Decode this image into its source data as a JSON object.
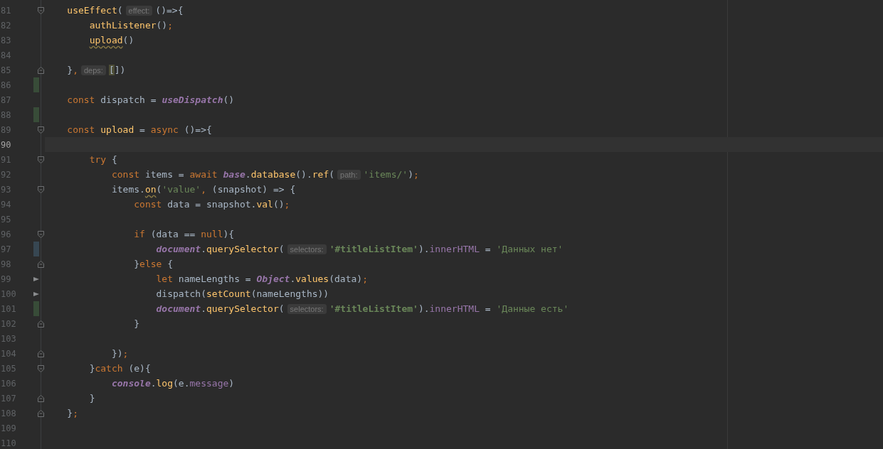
{
  "lines": [
    {
      "number": "81",
      "current": false,
      "added": false,
      "modified": false,
      "fold_start": true,
      "fold_end": false,
      "run_marker": false,
      "tokens": [
        {
          "text": "    useEffect",
          "kind": "function"
        },
        {
          "text": "(",
          "kind": "plain"
        },
        {
          "text": "effect:",
          "kind": "hint"
        },
        {
          "text": "()=>{",
          "kind": "plain"
        }
      ]
    },
    {
      "number": "82",
      "current": false,
      "added": false,
      "modified": false,
      "fold_start": false,
      "fold_end": false,
      "run_marker": false,
      "tokens": [
        {
          "text": "        authListener",
          "kind": "function"
        },
        {
          "text": "()",
          "kind": "plain"
        },
        {
          "text": ";",
          "kind": "punct"
        }
      ]
    },
    {
      "number": "83",
      "current": false,
      "added": false,
      "modified": false,
      "fold_start": false,
      "fold_end": false,
      "run_marker": false,
      "tokens": [
        {
          "text": "        upload",
          "kind": "function-warning"
        },
        {
          "text": "()",
          "kind": "plain"
        }
      ]
    },
    {
      "number": "84",
      "current": false,
      "added": false,
      "modified": false,
      "fold_start": false,
      "fold_end": false,
      "run_marker": false
    },
    {
      "number": "85",
      "current": false,
      "added": false,
      "modified": false,
      "fold_start": false,
      "fold_end": true,
      "run_marker": false,
      "tokens": [
        {
          "text": "    }",
          "kind": "plain"
        },
        {
          "text": ",",
          "kind": "punct"
        },
        {
          "text": "deps:",
          "kind": "hint"
        },
        {
          "text": "[",
          "kind": "bracket-match"
        },
        {
          "text": "])",
          "kind": "plain"
        }
      ]
    },
    {
      "number": "86",
      "current": false,
      "added": true,
      "modified": false,
      "fold_start": false,
      "fold_end": false,
      "run_marker": false
    },
    {
      "number": "87",
      "current": false,
      "added": false,
      "modified": false,
      "fold_start": false,
      "fold_end": false,
      "run_marker": false,
      "tokens": [
        {
          "text": "    const",
          "kind": "keyword"
        },
        {
          "text": " dispatch = ",
          "kind": "plain"
        },
        {
          "text": "useDispatch",
          "kind": "global"
        },
        {
          "text": "()",
          "kind": "plain"
        }
      ]
    },
    {
      "number": "88",
      "current": false,
      "added": true,
      "modified": false,
      "fold_start": false,
      "fold_end": false,
      "run_marker": false
    },
    {
      "number": "89",
      "current": false,
      "added": false,
      "modified": false,
      "fold_start": true,
      "fold_end": false,
      "run_marker": false,
      "tokens": [
        {
          "text": "    const",
          "kind": "keyword"
        },
        {
          "text": " upload",
          "kind": "function"
        },
        {
          "text": " = ",
          "kind": "plain"
        },
        {
          "text": "async",
          "kind": "keyword"
        },
        {
          "text": " ()=>{",
          "kind": "plain"
        }
      ]
    },
    {
      "number": "90",
      "current": true,
      "added": false,
      "modified": false,
      "fold_start": false,
      "fold_end": false,
      "run_marker": false
    },
    {
      "number": "91",
      "current": false,
      "added": false,
      "modified": false,
      "fold_start": true,
      "fold_end": false,
      "run_marker": false,
      "tokens": [
        {
          "text": "        try",
          "kind": "keyword"
        },
        {
          "text": " {",
          "kind": "plain"
        }
      ]
    },
    {
      "number": "92",
      "current": false,
      "added": false,
      "modified": false,
      "fold_start": false,
      "fold_end": false,
      "run_marker": false,
      "tokens": [
        {
          "text": "            const",
          "kind": "keyword"
        },
        {
          "text": " items = ",
          "kind": "plain"
        },
        {
          "text": "await ",
          "kind": "keyword"
        },
        {
          "text": "base",
          "kind": "global"
        },
        {
          "text": ".",
          "kind": "plain"
        },
        {
          "text": "database",
          "kind": "function"
        },
        {
          "text": "().",
          "kind": "plain"
        },
        {
          "text": "ref",
          "kind": "function"
        },
        {
          "text": "(",
          "kind": "plain"
        },
        {
          "text": "path:",
          "kind": "hint"
        },
        {
          "text": "'items/'",
          "kind": "string"
        },
        {
          "text": ")",
          "kind": "plain"
        },
        {
          "text": ";",
          "kind": "punct"
        }
      ]
    },
    {
      "number": "93",
      "current": false,
      "added": false,
      "modified": false,
      "fold_start": true,
      "fold_end": false,
      "run_marker": false,
      "tokens": [
        {
          "text": "            items.",
          "kind": "plain"
        },
        {
          "text": "on",
          "kind": "function-warning"
        },
        {
          "text": "(",
          "kind": "plain"
        },
        {
          "text": "'value'",
          "kind": "string"
        },
        {
          "text": ",",
          "kind": "punct"
        },
        {
          "text": " (snapshot) => {",
          "kind": "plain"
        }
      ]
    },
    {
      "number": "94",
      "current": false,
      "added": false,
      "modified": false,
      "fold_start": false,
      "fold_end": false,
      "run_marker": false,
      "tokens": [
        {
          "text": "                const",
          "kind": "keyword"
        },
        {
          "text": " data = snapshot.",
          "kind": "plain"
        },
        {
          "text": "val",
          "kind": "function"
        },
        {
          "text": "()",
          "kind": "plain"
        },
        {
          "text": ";",
          "kind": "punct"
        }
      ]
    },
    {
      "number": "95",
      "current": false,
      "added": false,
      "modified": false,
      "fold_start": false,
      "fold_end": false,
      "run_marker": false
    },
    {
      "number": "96",
      "current": false,
      "added": false,
      "modified": false,
      "fold_start": true,
      "fold_end": false,
      "run_marker": false,
      "tokens": [
        {
          "text": "                if",
          "kind": "keyword"
        },
        {
          "text": " (data == ",
          "kind": "plain"
        },
        {
          "text": "null",
          "kind": "keyword"
        },
        {
          "text": "){",
          "kind": "plain"
        }
      ]
    },
    {
      "number": "97",
      "current": false,
      "added": false,
      "modified": true,
      "fold_start": false,
      "fold_end": false,
      "run_marker": false,
      "tokens": [
        {
          "text": "                    document",
          "kind": "global"
        },
        {
          "text": ".",
          "kind": "plain"
        },
        {
          "text": "querySelector",
          "kind": "function"
        },
        {
          "text": "(",
          "kind": "plain"
        },
        {
          "text": "selectors:",
          "kind": "hint"
        },
        {
          "text": "'#titleListItem'",
          "kind": "string-bold"
        },
        {
          "text": ").",
          "kind": "plain"
        },
        {
          "text": "innerHTML",
          "kind": "property"
        },
        {
          "text": " = ",
          "kind": "plain"
        },
        {
          "text": "'Данных нет'",
          "kind": "string"
        }
      ]
    },
    {
      "number": "98",
      "current": false,
      "added": false,
      "modified": false,
      "fold_start": false,
      "fold_end": true,
      "run_marker": false,
      "tokens": [
        {
          "text": "                }",
          "kind": "plain"
        },
        {
          "text": "else",
          "kind": "keyword"
        },
        {
          "text": " {",
          "kind": "plain"
        }
      ]
    },
    {
      "number": "99",
      "current": false,
      "added": false,
      "modified": false,
      "fold_start": false,
      "fold_end": false,
      "run_marker": true,
      "tokens": [
        {
          "text": "                    let",
          "kind": "keyword"
        },
        {
          "text": " nameLengths = ",
          "kind": "plain"
        },
        {
          "text": "Object",
          "kind": "global"
        },
        {
          "text": ".",
          "kind": "plain"
        },
        {
          "text": "values",
          "kind": "function"
        },
        {
          "text": "(data)",
          "kind": "plain"
        },
        {
          "text": ";",
          "kind": "punct"
        }
      ]
    },
    {
      "number": "100",
      "current": false,
      "added": false,
      "modified": false,
      "fold_start": false,
      "fold_end": false,
      "run_marker": true,
      "tokens": [
        {
          "text": "                    dispatch(",
          "kind": "plain"
        },
        {
          "text": "setCount",
          "kind": "function"
        },
        {
          "text": "(nameLengths))",
          "kind": "plain"
        }
      ]
    },
    {
      "number": "101",
      "current": false,
      "added": true,
      "modified": false,
      "fold_start": false,
      "fold_end": false,
      "run_marker": false,
      "tokens": [
        {
          "text": "                    document",
          "kind": "global"
        },
        {
          "text": ".",
          "kind": "plain"
        },
        {
          "text": "querySelector",
          "kind": "function"
        },
        {
          "text": "(",
          "kind": "plain"
        },
        {
          "text": "selectors:",
          "kind": "hint"
        },
        {
          "text": "'#titleListItem'",
          "kind": "string-bold"
        },
        {
          "text": ").",
          "kind": "plain"
        },
        {
          "text": "innerHTML",
          "kind": "property"
        },
        {
          "text": " = ",
          "kind": "plain"
        },
        {
          "text": "'Данные есть'",
          "kind": "string"
        }
      ]
    },
    {
      "number": "102",
      "current": false,
      "added": false,
      "modified": false,
      "fold_start": false,
      "fold_end": true,
      "run_marker": false,
      "tokens": [
        {
          "text": "                }",
          "kind": "plain"
        }
      ]
    },
    {
      "number": "103",
      "current": false,
      "added": false,
      "modified": false,
      "fold_start": false,
      "fold_end": false,
      "run_marker": false
    },
    {
      "number": "104",
      "current": false,
      "added": false,
      "modified": false,
      "fold_start": false,
      "fold_end": true,
      "run_marker": false,
      "tokens": [
        {
          "text": "            })",
          "kind": "plain"
        },
        {
          "text": ";",
          "kind": "punct"
        }
      ]
    },
    {
      "number": "105",
      "current": false,
      "added": false,
      "modified": false,
      "fold_start": true,
      "fold_end": false,
      "run_marker": false,
      "tokens": [
        {
          "text": "        }",
          "kind": "plain"
        },
        {
          "text": "catch",
          "kind": "keyword"
        },
        {
          "text": " (e){",
          "kind": "plain"
        }
      ]
    },
    {
      "number": "106",
      "current": false,
      "added": false,
      "modified": false,
      "fold_start": false,
      "fold_end": false,
      "run_marker": false,
      "tokens": [
        {
          "text": "            console",
          "kind": "global"
        },
        {
          "text": ".",
          "kind": "plain"
        },
        {
          "text": "log",
          "kind": "function"
        },
        {
          "text": "(e.",
          "kind": "plain"
        },
        {
          "text": "message",
          "kind": "property"
        },
        {
          "text": ")",
          "kind": "plain"
        }
      ]
    },
    {
      "number": "107",
      "current": false,
      "added": false,
      "modified": false,
      "fold_start": false,
      "fold_end": true,
      "run_marker": false,
      "tokens": [
        {
          "text": "        }",
          "kind": "plain"
        }
      ]
    },
    {
      "number": "108",
      "current": false,
      "added": false,
      "modified": false,
      "fold_start": false,
      "fold_end": true,
      "run_marker": false,
      "tokens": [
        {
          "text": "    }",
          "kind": "plain"
        },
        {
          "text": ";",
          "kind": "punct"
        }
      ]
    },
    {
      "number": "109",
      "current": false,
      "added": false,
      "modified": false,
      "fold_start": false,
      "fold_end": false,
      "run_marker": false
    },
    {
      "number": "110",
      "current": false,
      "added": false,
      "modified": false,
      "fold_start": false,
      "fold_end": false,
      "run_marker": false
    }
  ]
}
